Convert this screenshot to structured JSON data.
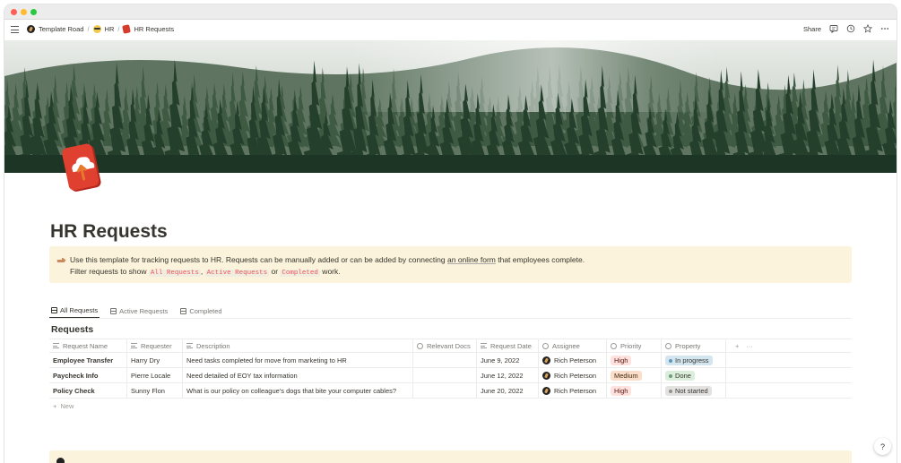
{
  "breadcrumbs": [
    {
      "label": "Template Road",
      "icon": "road-icon"
    },
    {
      "label": "HR",
      "icon": "sunglasses-emoji-icon"
    },
    {
      "label": "HR Requests",
      "icon": "cloud-upload-icon"
    }
  ],
  "topbar": {
    "share_label": "Share"
  },
  "page": {
    "title": "HR Requests"
  },
  "callout": {
    "icon": "pointing-hand-icon",
    "line1_before": "Use this template for tracking requests to HR. Requests can be manually added or can be added by connecting ",
    "line1_link": "an online form",
    "line1_after": " that employees complete.",
    "line2_before": "Filter requests to show ",
    "code1": "All Requests",
    "comma": ", ",
    "code2": "Active Requests",
    "or": " or ",
    "code3": "Completed",
    "line2_after": " work."
  },
  "tabs": [
    {
      "label": "All Requests",
      "active": true
    },
    {
      "label": "Active Requests",
      "active": false
    },
    {
      "label": "Completed",
      "active": false
    }
  ],
  "database": {
    "title": "Requests",
    "columns": [
      "Request Name",
      "Requester",
      "Description",
      "Relevant Docs",
      "Request Date",
      "Assignee",
      "Priority",
      "Property"
    ],
    "rows": [
      {
        "name": "Employee Transfer",
        "requester": "Harry Dry",
        "description": "Need tasks completed for move from marketing to HR",
        "docs": "",
        "date": "June 9, 2022",
        "assignee": "Rich Peterson",
        "priority": "High",
        "status": "In progress"
      },
      {
        "name": "Paycheck Info",
        "requester": "Pierre Locale",
        "description": "Need detailed of EOY tax information",
        "docs": "",
        "date": "June 12, 2022",
        "assignee": "Rich Peterson",
        "priority": "Medium",
        "status": "Done"
      },
      {
        "name": "Policy Check",
        "requester": "Sunny Flon",
        "description": "What is our policy on colleague's dogs that bite your computer cables?",
        "docs": "",
        "date": "June 20, 2022",
        "assignee": "Rich Peterson",
        "priority": "High",
        "status": "Not started"
      }
    ],
    "new_label": "New"
  },
  "colors": {
    "priority_high_bg": "#ffe2dd",
    "priority_high_fg": "#5d1715",
    "priority_medium_bg": "#fadec9",
    "priority_medium_fg": "#49290e",
    "status_in_progress_bg": "#d3e5ef",
    "status_in_progress_dot": "#5b97bd",
    "status_done_bg": "#dbeddb",
    "status_done_dot": "#6c9b7d",
    "status_not_started_bg": "#e3e2e0",
    "status_not_started_dot": "#91918e",
    "callout_bg": "#fbf3db"
  },
  "help": {
    "label": "?"
  }
}
